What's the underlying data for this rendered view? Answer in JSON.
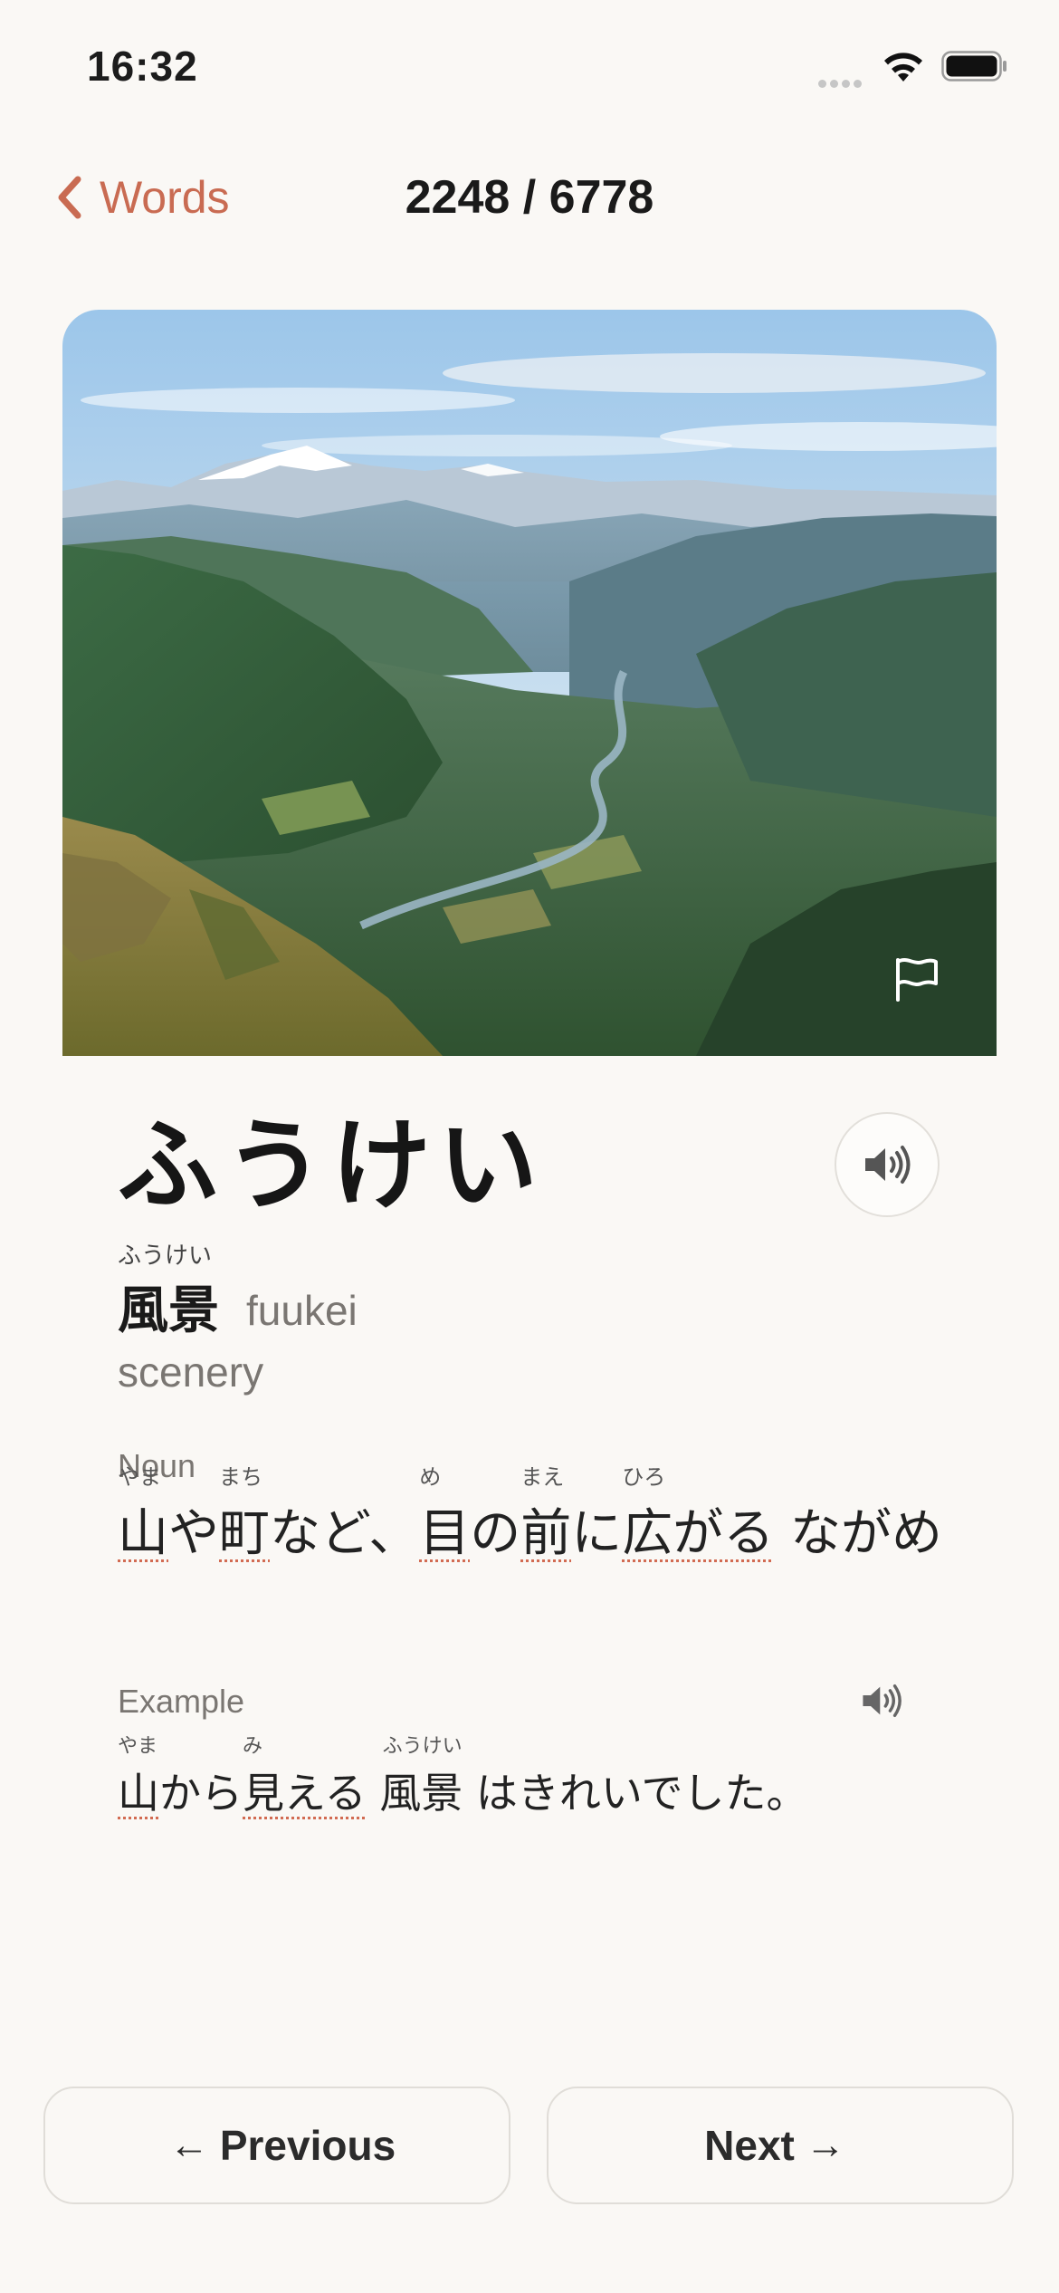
{
  "status_bar": {
    "time": "16:32"
  },
  "nav": {
    "back_label": "Words",
    "counter": "2248 / 6778"
  },
  "word": {
    "kana": "ふうけい",
    "kanji_ruby": "ふうけい",
    "kanji": "風景",
    "romaji": "fuukei",
    "meaning": "scenery"
  },
  "definition": {
    "pos": "Noun",
    "segments": [
      {
        "text": "山",
        "ruby": "やま",
        "underline": true
      },
      {
        "text": "や",
        "ruby": "",
        "underline": false
      },
      {
        "text": "町",
        "ruby": "まち",
        "underline": true
      },
      {
        "text": "など、",
        "ruby": "",
        "underline": false
      },
      {
        "text": "目",
        "ruby": "め",
        "underline": true
      },
      {
        "text": "の",
        "ruby": "",
        "underline": false
      },
      {
        "text": "前",
        "ruby": "まえ",
        "underline": true
      },
      {
        "text": "に",
        "ruby": "",
        "underline": false
      },
      {
        "text": "広がる",
        "ruby": "ひろ",
        "underline": true
      },
      {
        "text": " ながめ",
        "ruby": "",
        "underline": false
      }
    ]
  },
  "example": {
    "label": "Example",
    "segments": [
      {
        "text": "山",
        "ruby": "やま",
        "underline": true
      },
      {
        "text": "から",
        "ruby": "",
        "underline": false
      },
      {
        "text": "見える",
        "ruby": "み",
        "underline": true
      },
      {
        "text": " 風景",
        "ruby": "ふうけい",
        "underline": false
      },
      {
        "text": " はきれいでした。",
        "ruby": "",
        "underline": false
      }
    ]
  },
  "buttons": {
    "previous": "Previous",
    "next": "Next"
  },
  "colors": {
    "accent": "#c96b52",
    "background": "#faf8f5"
  },
  "icons": [
    "chevron-left-icon",
    "flag-icon",
    "speaker-icon",
    "arrow-left-icon",
    "arrow-right-icon",
    "wifi-icon",
    "battery-icon"
  ]
}
